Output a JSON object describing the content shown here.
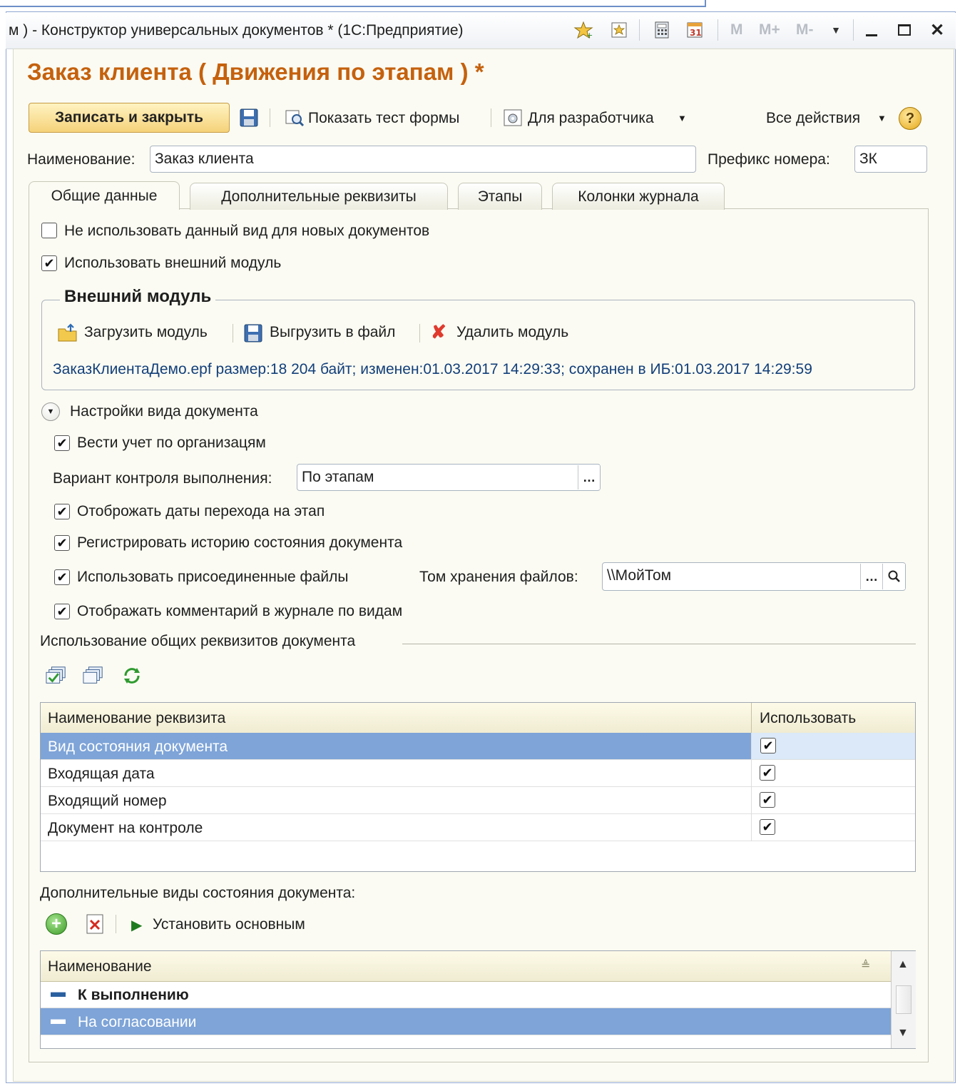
{
  "window": {
    "title": "м ) - Конструктор универсальных документов * (1С:Предприятие)",
    "toolbar_m_labels": [
      "M",
      "M+",
      "M-"
    ],
    "controls": [
      "minimize",
      "maximize",
      "close"
    ]
  },
  "form": {
    "title": "Заказ клиента ( Движения по этапам ) *",
    "toolbar": {
      "save_close": "Записать и закрыть",
      "show_test": "Показать тест формы",
      "developer": "Для разработчика",
      "all_actions": "Все действия",
      "help": "?"
    },
    "name_label": "Наименование:",
    "name_value": "Заказ клиента",
    "prefix_label": "Префикс номера:",
    "prefix_value": "ЗК",
    "tabs": [
      "Общие данные",
      "Дополнительные реквизиты",
      "Этапы",
      "Колонки журнала"
    ],
    "active_tab": "Общие данные"
  },
  "general": {
    "no_use_new": {
      "label": "Не использовать данный вид для новых документов",
      "checked": false
    },
    "use_external": {
      "label": "Использовать внешний модуль",
      "checked": true
    },
    "external_module": {
      "title": "Внешний модуль",
      "load": "Загрузить модуль",
      "unload": "Выгрузить в файл",
      "delete": "Удалить модуль",
      "info": "ЗаказКлиентаДемо.epf размер:18 204 байт; изменен:01.03.2017 14:29:33; сохранен в ИБ:01.03.2017 14:29:59"
    },
    "settings": {
      "title": "Настройки вида документа",
      "by_org": {
        "label": "Вести учет по организацям",
        "checked": true
      },
      "control_label": "Вариант контроля выполнения:",
      "control_value": "По этапам",
      "show_dates": {
        "label": "Отоброжать даты перехода на этап",
        "checked": true
      },
      "history": {
        "label": "Регистрировать историю состояния документа",
        "checked": true
      },
      "attached": {
        "label": "Использовать присоединенные файлы",
        "checked": true
      },
      "volume_label": "Том хранения файлов:",
      "volume_value": "\\\\МойТом",
      "comment": {
        "label": "Отображать комментарий в журнале по видам",
        "checked": true
      }
    },
    "attributes": {
      "title": "Использование общих реквизитов документа",
      "columns": [
        "Наименование реквизита",
        "Использовать"
      ],
      "rows": [
        {
          "name": "Вид состояния документа",
          "use": true
        },
        {
          "name": "Входящая дата",
          "use": true
        },
        {
          "name": "Входящий номер",
          "use": true
        },
        {
          "name": "Документ на контроле",
          "use": true
        }
      ]
    },
    "extra_states": {
      "title": "Дополнительные виды состояния документа:",
      "set_main": "Установить основным",
      "column": "Наименование",
      "rows": [
        "К выполнению",
        "На согласовании"
      ]
    }
  }
}
